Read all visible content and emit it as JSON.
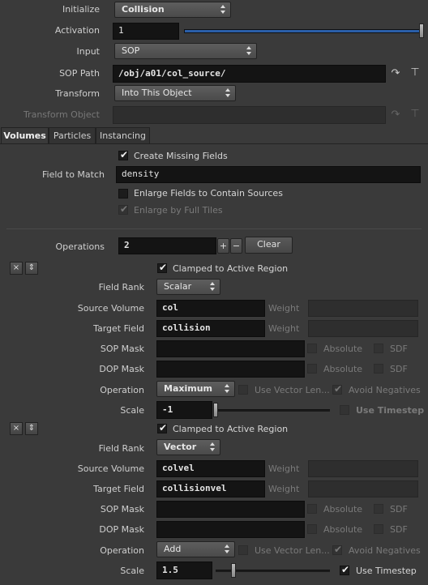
{
  "top": {
    "initialize": {
      "label": "Initialize",
      "value": "Collision"
    },
    "activation": {
      "label": "Activation",
      "value": "1"
    },
    "input": {
      "label": "Input",
      "value": "SOP"
    },
    "sop_path": {
      "label": "SOP Path",
      "value": "/obj/a01/col_source/"
    },
    "transform": {
      "label": "Transform",
      "value": "Into This Object"
    },
    "transform_object": {
      "label": "Transform Object",
      "value": ""
    }
  },
  "tabs": [
    "Volumes",
    "Particles",
    "Instancing"
  ],
  "volumes": {
    "create_missing": "Create Missing Fields",
    "field_to_match_label": "Field to Match",
    "field_to_match": "density",
    "enlarge_fields": "Enlarge Fields to Contain Sources",
    "enlarge_full_tiles": "Enlarge by Full Tiles",
    "operations_label": "Operations",
    "operations_value": "2",
    "plus": "+",
    "minus": "−",
    "clear": "Clear"
  },
  "entries": [
    {
      "clamped": "Clamped to Active Region",
      "field_rank_label": "Field Rank",
      "field_rank": "Scalar",
      "source_volume_label": "Source Volume",
      "source_volume": "col",
      "target_field_label": "Target Field",
      "target_field": "collision",
      "weight": "Weight",
      "sop_mask_label": "SOP Mask",
      "dop_mask_label": "DOP Mask",
      "absolute": "Absolute",
      "sdf": "SDF",
      "operation_label": "Operation",
      "operation": "Maximum",
      "use_vector_len": "Use Vector Len...",
      "avoid_negatives": "Avoid Negatives",
      "scale_label": "Scale",
      "scale": "-1",
      "scale_slider": 0.0,
      "use_timestep": "Use Timestep",
      "use_timestep_checked": false
    },
    {
      "clamped": "Clamped to Active Region",
      "field_rank_label": "Field Rank",
      "field_rank": "Vector",
      "source_volume_label": "Source Volume",
      "source_volume": "colvel",
      "target_field_label": "Target Field",
      "target_field": "collisionvel",
      "weight": "Weight",
      "sop_mask_label": "SOP Mask",
      "dop_mask_label": "DOP Mask",
      "absolute": "Absolute",
      "sdf": "SDF",
      "operation_label": "Operation",
      "operation": "Add",
      "use_vector_len": "Use Vector Len...",
      "avoid_negatives": "Avoid Negatives",
      "scale_label": "Scale",
      "scale": "1.5",
      "scale_slider": 0.15,
      "use_timestep": "Use Timestep",
      "use_timestep_checked": true
    }
  ],
  "icons": {
    "remove": "×",
    "move": "⇕",
    "jump": "↷",
    "picker": "⊤"
  }
}
